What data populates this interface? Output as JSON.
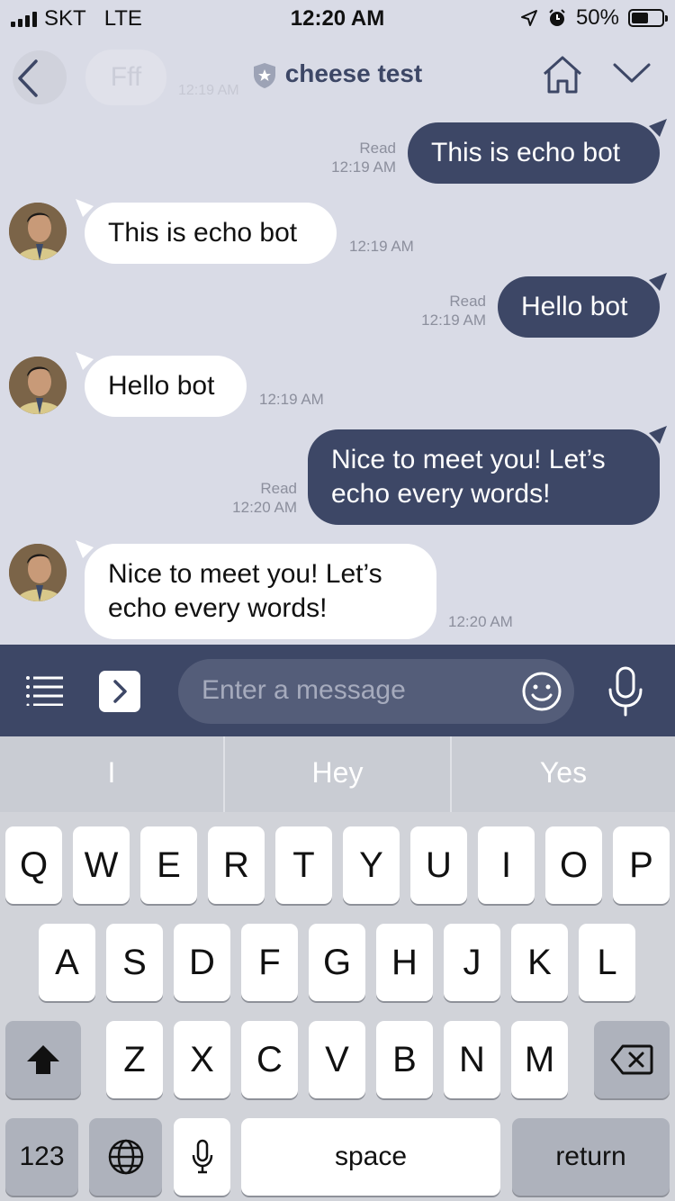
{
  "status_bar": {
    "carrier": "SKT",
    "network": "LTE",
    "time": "12:20 AM",
    "battery": "50%",
    "battery_level": 0.5
  },
  "header": {
    "title": "cheese test",
    "ghost_bubble_text": "Fff",
    "ghost_time": "12:19 AM"
  },
  "messages": [
    {
      "dir": "out",
      "lines": [
        "This is echo bot"
      ],
      "status": "Read",
      "time": "12:19 AM"
    },
    {
      "dir": "in",
      "lines": [
        "This is echo bot"
      ],
      "time": "12:19 AM"
    },
    {
      "dir": "out",
      "lines": [
        "Hello bot"
      ],
      "status": "Read",
      "time": "12:19 AM"
    },
    {
      "dir": "in",
      "lines": [
        "Hello bot"
      ],
      "time": "12:19 AM"
    },
    {
      "dir": "out",
      "lines": [
        "Nice to meet you! Let’s",
        "echo every words!"
      ],
      "status": "Read",
      "time": "12:20 AM"
    },
    {
      "dir": "in",
      "lines": [
        "Nice to meet you! Let’s",
        "echo every words!"
      ],
      "time": "12:20 AM"
    }
  ],
  "input": {
    "placeholder": "Enter a message"
  },
  "keyboard": {
    "suggestions": [
      "I",
      "Hey",
      "Yes"
    ],
    "row1": [
      "Q",
      "W",
      "E",
      "R",
      "T",
      "Y",
      "U",
      "I",
      "O",
      "P"
    ],
    "row2": [
      "A",
      "S",
      "D",
      "F",
      "G",
      "H",
      "J",
      "K",
      "L"
    ],
    "row3": [
      "Z",
      "X",
      "C",
      "V",
      "B",
      "N",
      "M"
    ],
    "numbers_label": "123",
    "space_label": "space",
    "return_label": "return"
  },
  "colors": {
    "accent": "#3d4766",
    "background": "#d9dbe6"
  }
}
